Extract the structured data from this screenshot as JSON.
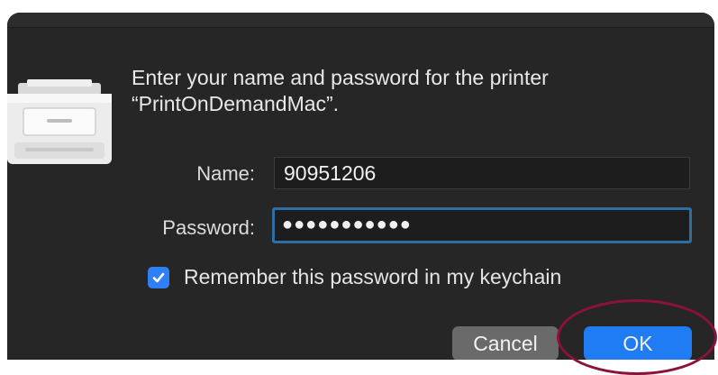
{
  "dialog": {
    "message_line1": "Enter your name and password for the printer",
    "message_line2": "“PrintOnDemandMac”."
  },
  "form": {
    "name_label": "Name:",
    "name_value": "90951206",
    "password_label": "Password:",
    "password_value": "●●●●●●●●●●●",
    "remember_checked": true,
    "remember_label": "Remember this password in my keychain"
  },
  "buttons": {
    "cancel_label": "Cancel",
    "ok_label": "OK"
  },
  "colors": {
    "background": "#262626",
    "accent": "#1f7cf2",
    "focus_ring": "#2d6fa3",
    "annotation": "#8c1237"
  },
  "icons": {
    "printer": "printer-icon",
    "checkbox": "checkmark-icon"
  }
}
